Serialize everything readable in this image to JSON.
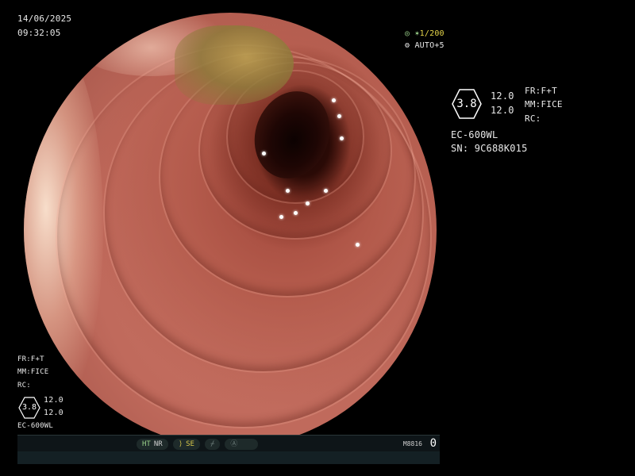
{
  "date": "14/06/2025",
  "time": "09:32:05",
  "shutter": "1/200",
  "iris": "AUTO+5",
  "right_panel": {
    "scale_value": "3.8",
    "val_a": "12.0",
    "val_b": "12.0",
    "fr": "FR:F+T",
    "mm": "MM:FICE",
    "rc": "RC:",
    "model": "EC-600WL",
    "serial": "SN: 9C688K015"
  },
  "left_panel": {
    "fr": "FR:F+T",
    "mm": "MM:FICE",
    "rc": "RC:",
    "scale_value": "3.8",
    "val_a": "12.0",
    "val_b": "12.0",
    "model": "EC-600WL"
  },
  "status_bar": {
    "ht": "HT",
    "nr": "NR",
    "se": "SE",
    "code": "M8816",
    "counter": "0"
  },
  "colors": {
    "osd_text": "#e8e8e8",
    "shutter_yellow": "#e8d84a",
    "status_green": "#9ad08a"
  }
}
